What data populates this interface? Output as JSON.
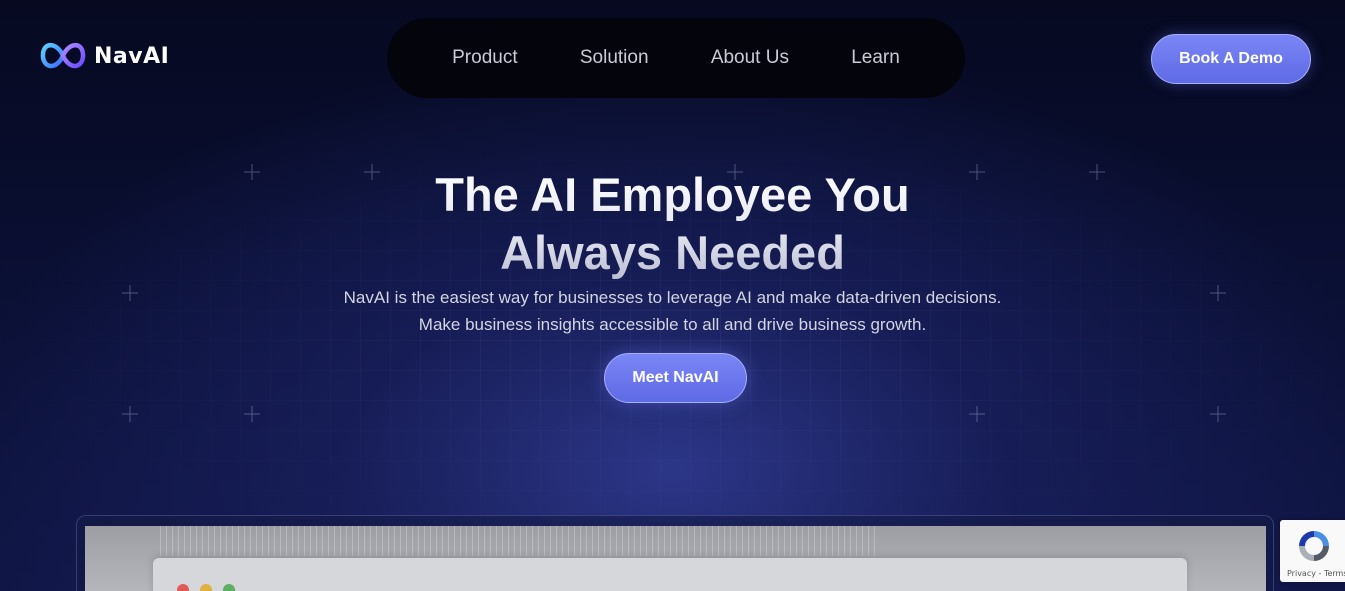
{
  "brand": {
    "name": "NavAI",
    "logo_icon": "navai-infinity-logo-icon"
  },
  "nav": {
    "items": [
      {
        "label": "Product"
      },
      {
        "label": "Solution"
      },
      {
        "label": "About Us"
      },
      {
        "label": "Learn"
      }
    ]
  },
  "header": {
    "cta_label": "Book A Demo"
  },
  "hero": {
    "title_line1": "The AI Employee You",
    "title_line2": "Always Needed",
    "subtitle_line1": "NavAI is the easiest way for businesses to leverage AI and make data-driven decisions.",
    "subtitle_line2": "Make business insights accessible to all and drive business growth.",
    "cta_label": "Meet NavAI"
  },
  "recaptcha": {
    "icon": "recaptcha-icon",
    "text": "Privacy - Terms"
  },
  "colors": {
    "background": "#070a24",
    "accent": "#6b76ee",
    "nav_pill": "#03040c"
  }
}
